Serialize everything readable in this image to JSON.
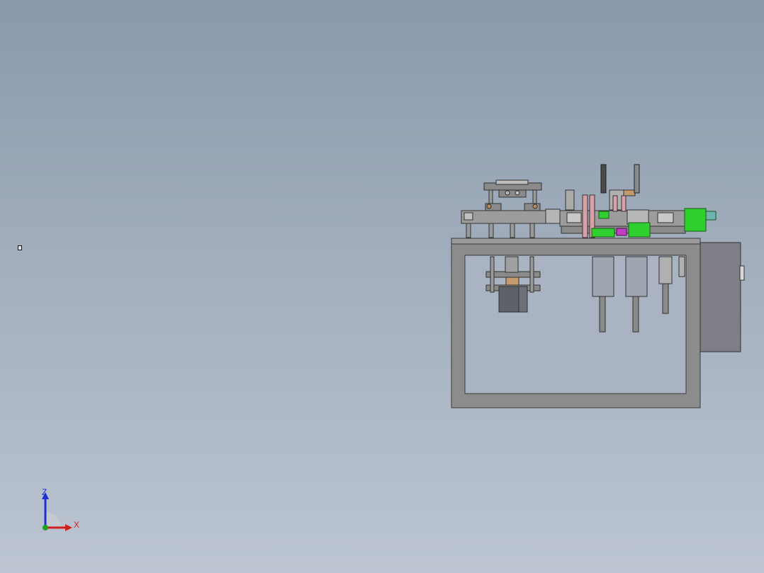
{
  "triad": {
    "z_label": "Z",
    "x_label": "X",
    "colors": {
      "z": "#1f2fd0",
      "x": "#d01f1f",
      "y": "#1fa01f"
    }
  },
  "model": {
    "frame_color": "#8c8c8c",
    "cabinet_color": "#7e7e86",
    "accent_green": "#2fcf2f",
    "accent_pink": "#d8a0a8",
    "accent_magenta": "#c040c0"
  }
}
